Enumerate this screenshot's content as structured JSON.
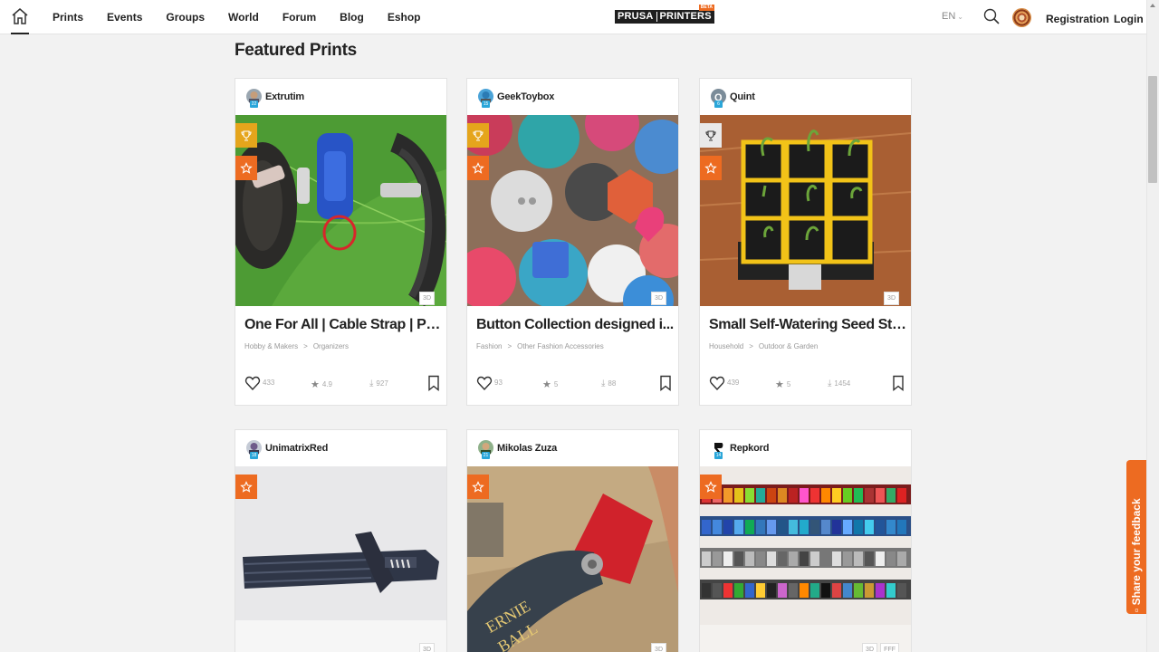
{
  "nav": {
    "items": [
      "Prints",
      "Events",
      "Groups",
      "World",
      "Forum",
      "Blog",
      "Eshop"
    ],
    "logo_left": "PRUSA",
    "logo_right": "PRINTERS",
    "logo_badge": "BETA",
    "language": "EN",
    "registration": "Registration",
    "login": "Login"
  },
  "section_title": "Featured Prints",
  "feedback_label": "Share your feedback",
  "cards": [
    {
      "author": "Extrutim",
      "level": "22",
      "title": "One For All | Cable Strap | Prin...",
      "category": "Hobby & Makers",
      "subcategory": "Organizers",
      "likes": "433",
      "rating": "4.9",
      "downloads": "927",
      "tag": "3D",
      "trophy": true
    },
    {
      "author": "GeekToybox",
      "level": "15",
      "title": "Button Collection designed i...",
      "category": "Fashion",
      "subcategory": "Other Fashion Accessories",
      "likes": "93",
      "rating": "5",
      "downloads": "88",
      "tag": "3D",
      "trophy": true
    },
    {
      "author": "Quint",
      "level": "6",
      "title": "Small Self-Watering Seed Sta...",
      "category": "Household",
      "subcategory": "Outdoor & Garden",
      "likes": "439",
      "rating": "5",
      "downloads": "1454",
      "tag": "3D",
      "trophy": true
    },
    {
      "author": "UnimatrixRed",
      "level": "18",
      "tag": "3D"
    },
    {
      "author": "Mikolas Zuza",
      "level": "21",
      "tag": "3D"
    },
    {
      "author": "Repkord",
      "level": "14",
      "tag": "3D",
      "tag2": "FFF"
    }
  ],
  "colors": {
    "accent": "#ed6b21",
    "trophy": "#e5a51c",
    "level": "#2aa6d9"
  },
  "category_separator": ">"
}
